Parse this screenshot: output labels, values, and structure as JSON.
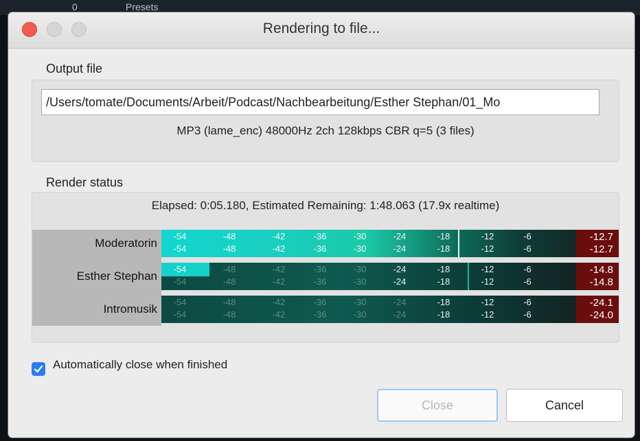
{
  "background": {
    "partial_labels": [
      "0",
      "Presets"
    ]
  },
  "dialog": {
    "title": "Rendering to file..."
  },
  "output_file": {
    "group_label": "Output file",
    "path_value": "/Users/tomate/Documents/Arbeit/Podcast/Nachbearbeitung/Esther Stephan/01_Mo",
    "format_info": "MP3 (lame_enc) 48000Hz 2ch 128kbps CBR q=5 (3 files)"
  },
  "render_status": {
    "group_label": "Render status",
    "elapsed_info": "Elapsed: 0:05.180, Estimated Remaining: 1:48.063 (17.9x realtime)",
    "scale_ticks": [
      "-54",
      "-48",
      "-42",
      "-36",
      "-30",
      "-24",
      "-18",
      "-12",
      "-6"
    ],
    "tracks": [
      {
        "name": "Moderatorin",
        "peak_left": "-12.7",
        "peak_right": "-12.7"
      },
      {
        "name": "Esther Stephan",
        "peak_left": "-14.8",
        "peak_right": "-14.8"
      },
      {
        "name": "Intromusik",
        "peak_left": "-24.1",
        "peak_right": "-24.0"
      }
    ]
  },
  "auto_close": {
    "label": "Automatically close when finished",
    "checked": true
  },
  "buttons": {
    "close": "Close",
    "cancel": "Cancel"
  },
  "colors": {
    "accent_blue": "#2a7cf4",
    "meter_teal": "#14d2c9",
    "peak_red": "#6a0d0d",
    "traffic_red": "#f05a50"
  }
}
